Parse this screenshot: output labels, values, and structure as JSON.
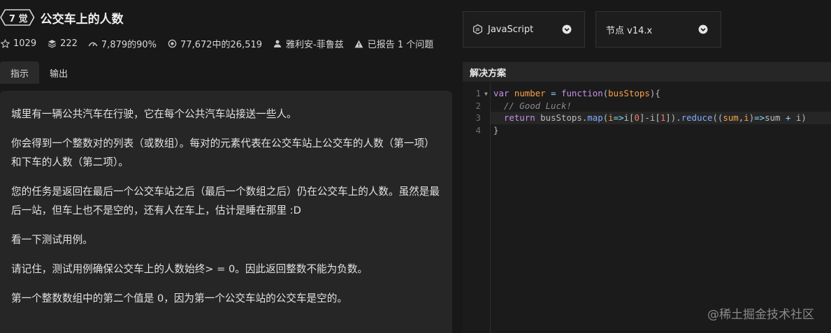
{
  "kata": {
    "rank": "7 觉",
    "title": "公交车上的人数"
  },
  "stats": {
    "stars": "1029",
    "collections": "222",
    "satisfaction": "7,879的90%",
    "completions": "77,672中的26,519",
    "author": "雅利安-菲鲁兹",
    "issues": "已报告 1 个问题"
  },
  "tabs": [
    {
      "label": "指示",
      "active": true
    },
    {
      "label": "输出",
      "active": false
    }
  ],
  "description": {
    "paragraphs": [
      "城里有一辆公共汽车在行驶，它在每个公共汽车站接送一些人。",
      "你会得到一个整数对的列表（或数组）。每对的元素代表在公交车站上公交车的人数（第一项）和下车的人数（第二项）。",
      "您的任务是返回在最后一个公交车站之后（最后一个数组之后）仍在公交车上的人数。虽然是最后一站，但车上也不是空的，还有人在车上，估计是睡在那里 :D",
      "看一下测试用例。",
      "请记住，测试用例确保公交车上的人数始终> = 0。因此返回整数不能为负数。",
      "第一个整数数组中的第二个值是 0，因为第一个公交车站的公交车是空的。"
    ]
  },
  "language_select": {
    "value": "JavaScript"
  },
  "version_select": {
    "value": "节点 v14.x"
  },
  "solution": {
    "header": "解决方案",
    "line_numbers": [
      "1",
      "2",
      "3",
      "4"
    ],
    "tokens": {
      "l1_kw": "var",
      "l1_var": "number",
      "l1_eq": " = ",
      "l1_fn": "function",
      "l1_open": "(",
      "l1_param": "busStops",
      "l1_close": "){",
      "l2_comment": "// Good Luck!",
      "l3_kw": "return",
      "l3_obj": " busStops",
      "l3_dot1": ".",
      "l3_map": "map",
      "l3_p1": "(",
      "l3_i1": "i",
      "l3_arrow1": "=>",
      "l3_i2": "i",
      "l3_b1": "[",
      "l3_n0": "0",
      "l3_b2": "]",
      "l3_minus": "-",
      "l3_i3": "i",
      "l3_b3": "[",
      "l3_n1": "1",
      "l3_b4": "])",
      "l3_dot2": ".",
      "l3_reduce": "reduce",
      "l3_p2": "((",
      "l3_sum": "sum",
      "l3_comma": ",",
      "l3_i4": "i",
      "l3_p3": ")",
      "l3_arrow2": "=>",
      "l3_sum2": "sum",
      "l3_plus": " + ",
      "l3_i5": "i",
      "l3_p4": ")",
      "l4_close": "}"
    }
  },
  "watermark": "@稀土掘金技术社区",
  "icons": {
    "stars": "star-icon",
    "collections": "layers-icon",
    "satisfaction": "thumb-icon",
    "completions": "target-icon",
    "author": "user-icon",
    "issues": "warning-icon",
    "language": "javascript-icon",
    "dropdown": "chevron-down-icon"
  }
}
